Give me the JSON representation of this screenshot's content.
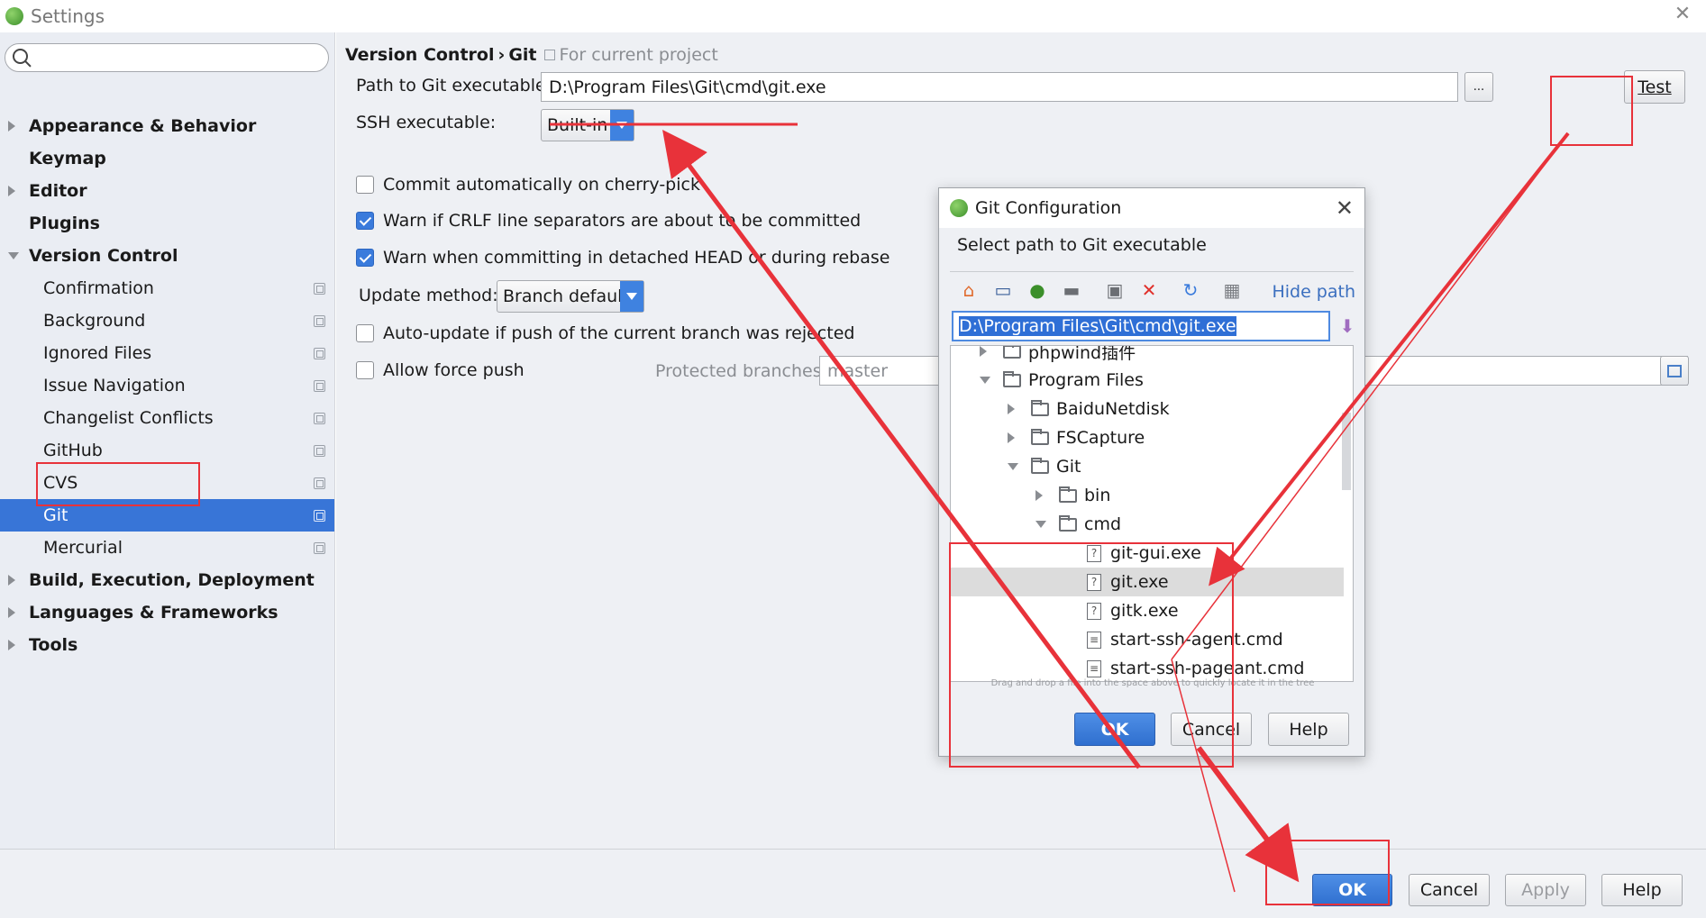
{
  "window": {
    "title": "Settings"
  },
  "search": {
    "placeholder": ""
  },
  "sidebar": {
    "items": [
      {
        "label": "Appearance & Behavior",
        "level": "top",
        "arrow": "right"
      },
      {
        "label": "Keymap",
        "level": "top",
        "arrow": ""
      },
      {
        "label": "Editor",
        "level": "top",
        "arrow": "right"
      },
      {
        "label": "Plugins",
        "level": "top",
        "arrow": ""
      },
      {
        "label": "Version Control",
        "level": "top",
        "arrow": "down"
      },
      {
        "label": "Confirmation",
        "level": "child"
      },
      {
        "label": "Background",
        "level": "child"
      },
      {
        "label": "Ignored Files",
        "level": "child"
      },
      {
        "label": "Issue Navigation",
        "level": "child"
      },
      {
        "label": "Changelist Conflicts",
        "level": "child"
      },
      {
        "label": "GitHub",
        "level": "child"
      },
      {
        "label": "CVS",
        "level": "child"
      },
      {
        "label": "Git",
        "level": "child",
        "selected": true
      },
      {
        "label": "Mercurial",
        "level": "child"
      },
      {
        "label": "Build, Execution, Deployment",
        "level": "top",
        "arrow": "right"
      },
      {
        "label": "Languages & Frameworks",
        "level": "top",
        "arrow": "right"
      },
      {
        "label": "Tools",
        "level": "top",
        "arrow": "right"
      }
    ]
  },
  "main": {
    "breadcrumb": {
      "parent": "Version Control",
      "separator": "›",
      "current": "Git",
      "scope": "For current project"
    },
    "path_label": "Path to Git executable:",
    "path_value": "D:\\Program Files\\Git\\cmd\\git.exe",
    "browse_label": "...",
    "test_label": "Test",
    "ssh_label": "SSH executable:",
    "ssh_value": "Built-in",
    "checks": [
      {
        "label": "Commit automatically on cherry-pick",
        "checked": false
      },
      {
        "label": "Warn if CRLF line separators are about to be committed",
        "checked": true
      },
      {
        "label": "Warn when committing in detached HEAD or during rebase",
        "checked": true
      }
    ],
    "update_label": "Update method:",
    "update_value": "Branch default",
    "auto_update_label": "Auto-update if push of the current branch was rejected",
    "force_push_label": "Allow force push",
    "protected_label": "Protected branches:",
    "protected_value": "master"
  },
  "footer": {
    "ok": "OK",
    "cancel": "Cancel",
    "apply": "Apply",
    "help": "Help"
  },
  "dialog": {
    "title": "Git Configuration",
    "description": "Select path to Git executable",
    "hide_path": "Hide path",
    "path_value": "D:\\Program Files\\Git\\cmd\\git.exe",
    "toolbar_icons": [
      "home-icon",
      "desktop-icon",
      "project-icon",
      "folder-icon",
      "new-folder-icon",
      "delete-icon",
      "refresh-icon",
      "show-hidden-icon"
    ],
    "tree": [
      {
        "label": "phpwind插件",
        "type": "folder",
        "depth": 1,
        "arrow": "right"
      },
      {
        "label": "Program Files",
        "type": "folder",
        "depth": 1,
        "arrow": "down"
      },
      {
        "label": "BaiduNetdisk",
        "type": "folder",
        "depth": 2,
        "arrow": "right"
      },
      {
        "label": "FSCapture",
        "type": "folder",
        "depth": 2,
        "arrow": "right"
      },
      {
        "label": "Git",
        "type": "folder",
        "depth": 2,
        "arrow": "down"
      },
      {
        "label": "bin",
        "type": "folder",
        "depth": 3,
        "arrow": "right"
      },
      {
        "label": "cmd",
        "type": "folder",
        "depth": 3,
        "arrow": "down"
      },
      {
        "label": "git-gui.exe",
        "type": "file",
        "depth": 4
      },
      {
        "label": "git.exe",
        "type": "file",
        "depth": 4,
        "selected": true
      },
      {
        "label": "gitk.exe",
        "type": "file",
        "depth": 4
      },
      {
        "label": "start-ssh-agent.cmd",
        "type": "doc",
        "depth": 4
      },
      {
        "label": "start-ssh-pageant.cmd",
        "type": "doc",
        "depth": 4
      }
    ],
    "drag_hint": "Drag and drop a file into the space above to quickly locate it in the tree",
    "ok": "OK",
    "cancel": "Cancel",
    "help": "Help"
  },
  "colors": {
    "accent": "#3875d7",
    "annotation": "#e8323a",
    "sidebar_bg": "#eaedf3"
  }
}
